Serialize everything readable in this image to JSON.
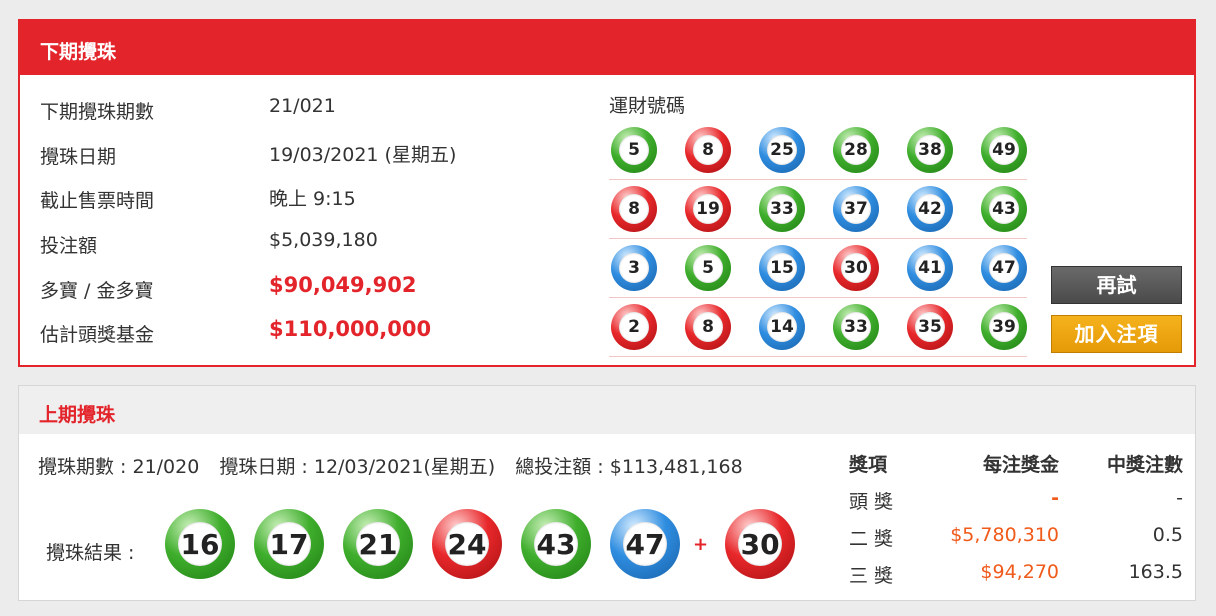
{
  "next_draw": {
    "header": "下期攪珠",
    "info": [
      {
        "label": "下期攪珠期數",
        "value": "21/021",
        "highlight": false
      },
      {
        "label": "攪珠日期",
        "value": "19/03/2021 (星期五)",
        "highlight": false
      },
      {
        "label": "截止售票時間",
        "value": "晚上 9:15",
        "highlight": false
      },
      {
        "label": "投注額",
        "value": "$5,039,180",
        "highlight": false
      },
      {
        "label": "多寶 / 金多寶",
        "value": "$90,049,902",
        "highlight": true
      },
      {
        "label": "估計頭獎基金",
        "value": "$110,000,000",
        "highlight": true
      }
    ],
    "lucky_title": "運財號碼",
    "lucky_numbers": [
      [
        {
          "n": "5",
          "c": "green"
        },
        {
          "n": "8",
          "c": "red"
        },
        {
          "n": "25",
          "c": "blue"
        },
        {
          "n": "28",
          "c": "green"
        },
        {
          "n": "38",
          "c": "green"
        },
        {
          "n": "49",
          "c": "green"
        }
      ],
      [
        {
          "n": "8",
          "c": "red"
        },
        {
          "n": "19",
          "c": "red"
        },
        {
          "n": "33",
          "c": "green"
        },
        {
          "n": "37",
          "c": "blue"
        },
        {
          "n": "42",
          "c": "blue"
        },
        {
          "n": "43",
          "c": "green"
        }
      ],
      [
        {
          "n": "3",
          "c": "blue"
        },
        {
          "n": "5",
          "c": "green"
        },
        {
          "n": "15",
          "c": "blue"
        },
        {
          "n": "30",
          "c": "red"
        },
        {
          "n": "41",
          "c": "blue"
        },
        {
          "n": "47",
          "c": "blue"
        }
      ],
      [
        {
          "n": "2",
          "c": "red"
        },
        {
          "n": "8",
          "c": "red"
        },
        {
          "n": "14",
          "c": "blue"
        },
        {
          "n": "33",
          "c": "green"
        },
        {
          "n": "35",
          "c": "red"
        },
        {
          "n": "39",
          "c": "green"
        }
      ]
    ],
    "retry_label": "再試",
    "add_label": "加入注項"
  },
  "last_draw": {
    "header": "上期攪珠",
    "draw_no": "攪珠期數 : 21/020",
    "draw_date": "攪珠日期 : 12/03/2021(星期五)",
    "turnover": "總投注額 : $113,481,168",
    "result_label": "攪珠結果 :",
    "results": [
      {
        "n": "16",
        "c": "green"
      },
      {
        "n": "17",
        "c": "green"
      },
      {
        "n": "21",
        "c": "green"
      },
      {
        "n": "24",
        "c": "red"
      },
      {
        "n": "43",
        "c": "green"
      },
      {
        "n": "47",
        "c": "blue"
      }
    ],
    "plus": "+",
    "extra": {
      "n": "30",
      "c": "red"
    },
    "prize_headers": {
      "division": "獎項",
      "prize": "每注獎金",
      "winners": "中獎注數"
    },
    "prizes": [
      {
        "division": "頭 獎",
        "prize": "-",
        "winners": "-"
      },
      {
        "division": "二 獎",
        "prize": "$5,780,310",
        "winners": "0.5"
      },
      {
        "division": "三 獎",
        "prize": "$94,270",
        "winners": "163.5"
      }
    ]
  },
  "colors": {
    "accent": "#e3242b",
    "prize": "#f05a1a",
    "add_button": "#f5b21d",
    "retry_button": "#555555"
  }
}
